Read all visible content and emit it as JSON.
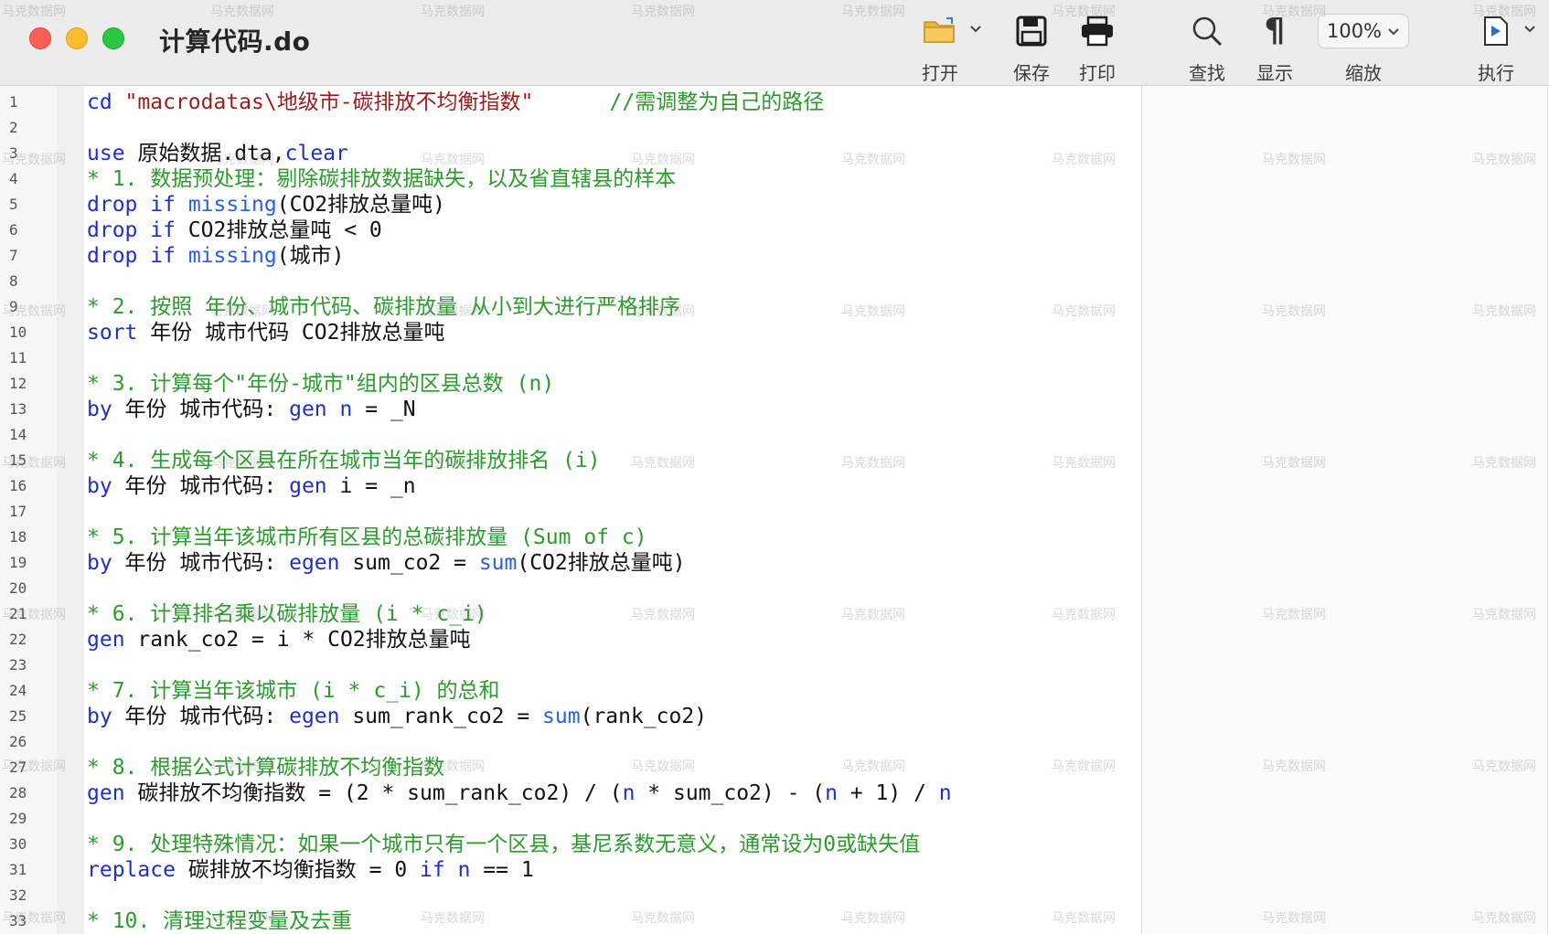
{
  "window": {
    "title": "计算代码.do"
  },
  "toolbar": {
    "open": "打开",
    "save": "保存",
    "print": "打印",
    "find": "查找",
    "show": "显示",
    "zoom_value": "100%",
    "zoom": "缩放",
    "execute": "执行"
  },
  "icons": {
    "open": "folder-icon",
    "save": "floppy-disk-icon",
    "print": "printer-icon",
    "find": "magnifier-icon",
    "show": "pilcrow-icon",
    "execute": "run-document-icon"
  },
  "colors": {
    "keyword": "#1f2fc7",
    "function": "#2a5fe0",
    "string": "#9b1c1c",
    "comment": "#2d9a2d",
    "close": "#fe5f57",
    "minimize": "#febc2e",
    "zoom": "#28c840"
  },
  "watermark": "马克数据网",
  "code_lines": [
    [
      {
        "t": "kw",
        "s": "cd "
      },
      {
        "t": "str",
        "s": "\"macrodatas\\地级市-碳排放不均衡指数\""
      },
      {
        "t": "tx",
        "s": "      "
      },
      {
        "t": "cm",
        "s": "//需调整为自己的路径"
      }
    ],
    [],
    [
      {
        "t": "kw",
        "s": "use"
      },
      {
        "t": "tx",
        "s": " 原始数据.dta,"
      },
      {
        "t": "kw",
        "s": "clear"
      }
    ],
    [
      {
        "t": "cm",
        "s": "* 1. 数据预处理：剔除碳排放数据缺失，以及省直辖县的样本"
      }
    ],
    [
      {
        "t": "kw",
        "s": "drop"
      },
      {
        "t": "tx",
        "s": " "
      },
      {
        "t": "kw",
        "s": "if"
      },
      {
        "t": "tx",
        "s": " "
      },
      {
        "t": "fn",
        "s": "missing"
      },
      {
        "t": "tx",
        "s": "(CO2排放总量吨)"
      }
    ],
    [
      {
        "t": "kw",
        "s": "drop"
      },
      {
        "t": "tx",
        "s": " "
      },
      {
        "t": "kw",
        "s": "if"
      },
      {
        "t": "tx",
        "s": " CO2排放总量吨 < 0"
      }
    ],
    [
      {
        "t": "kw",
        "s": "drop"
      },
      {
        "t": "tx",
        "s": " "
      },
      {
        "t": "kw",
        "s": "if"
      },
      {
        "t": "tx",
        "s": " "
      },
      {
        "t": "fn",
        "s": "missing"
      },
      {
        "t": "tx",
        "s": "(城市)"
      }
    ],
    [],
    [
      {
        "t": "cm",
        "s": "* 2. 按照 年份、城市代码、碳排放量 从小到大进行严格排序"
      }
    ],
    [
      {
        "t": "kw",
        "s": "sort"
      },
      {
        "t": "tx",
        "s": " 年份 城市代码 CO2排放总量吨"
      }
    ],
    [],
    [
      {
        "t": "cm",
        "s": "* 3. 计算每个\"年份-城市\"组内的区县总数 (n)"
      }
    ],
    [
      {
        "t": "kw",
        "s": "by"
      },
      {
        "t": "tx",
        "s": " 年份 城市代码: "
      },
      {
        "t": "kw",
        "s": "gen"
      },
      {
        "t": "tx",
        "s": " "
      },
      {
        "t": "kw",
        "s": "n"
      },
      {
        "t": "tx",
        "s": " = _N"
      }
    ],
    [],
    [
      {
        "t": "cm",
        "s": "* 4. 生成每个区县在所在城市当年的碳排放排名 (i)"
      }
    ],
    [
      {
        "t": "kw",
        "s": "by"
      },
      {
        "t": "tx",
        "s": " 年份 城市代码: "
      },
      {
        "t": "kw",
        "s": "gen"
      },
      {
        "t": "tx",
        "s": " i = _n"
      }
    ],
    [],
    [
      {
        "t": "cm",
        "s": "* 5. 计算当年该城市所有区县的总碳排放量 (Sum of c)"
      }
    ],
    [
      {
        "t": "kw",
        "s": "by"
      },
      {
        "t": "tx",
        "s": " 年份 城市代码: "
      },
      {
        "t": "kw",
        "s": "egen"
      },
      {
        "t": "tx",
        "s": " sum_co2 = "
      },
      {
        "t": "fn",
        "s": "sum"
      },
      {
        "t": "tx",
        "s": "(CO2排放总量吨)"
      }
    ],
    [],
    [
      {
        "t": "cm",
        "s": "* 6. 计算排名乘以碳排放量 (i * c_i)"
      }
    ],
    [
      {
        "t": "kw",
        "s": "gen"
      },
      {
        "t": "tx",
        "s": " rank_co2 = i * CO2排放总量吨"
      }
    ],
    [],
    [
      {
        "t": "cm",
        "s": "* 7. 计算当年该城市 (i * c_i) 的总和"
      }
    ],
    [
      {
        "t": "kw",
        "s": "by"
      },
      {
        "t": "tx",
        "s": " 年份 城市代码: "
      },
      {
        "t": "kw",
        "s": "egen"
      },
      {
        "t": "tx",
        "s": " sum_rank_co2 = "
      },
      {
        "t": "fn",
        "s": "sum"
      },
      {
        "t": "tx",
        "s": "(rank_co2)"
      }
    ],
    [],
    [
      {
        "t": "cm",
        "s": "* 8. 根据公式计算碳排放不均衡指数"
      }
    ],
    [
      {
        "t": "kw",
        "s": "gen"
      },
      {
        "t": "tx",
        "s": " 碳排放不均衡指数 = (2 * sum_rank_co2) / ("
      },
      {
        "t": "kw",
        "s": "n"
      },
      {
        "t": "tx",
        "s": " * sum_co2) - ("
      },
      {
        "t": "kw",
        "s": "n"
      },
      {
        "t": "tx",
        "s": " + 1) / "
      },
      {
        "t": "kw",
        "s": "n"
      }
    ],
    [],
    [
      {
        "t": "cm",
        "s": "* 9. 处理特殊情况：如果一个城市只有一个区县，基尼系数无意义，通常设为0或缺失值"
      }
    ],
    [
      {
        "t": "kw",
        "s": "replace"
      },
      {
        "t": "tx",
        "s": " 碳排放不均衡指数 = 0 "
      },
      {
        "t": "kw",
        "s": "if"
      },
      {
        "t": "tx",
        "s": " "
      },
      {
        "t": "kw",
        "s": "n"
      },
      {
        "t": "tx",
        "s": " == 1"
      }
    ],
    [],
    [
      {
        "t": "cm",
        "s": "* 10. 清理过程变量及去重"
      }
    ]
  ]
}
